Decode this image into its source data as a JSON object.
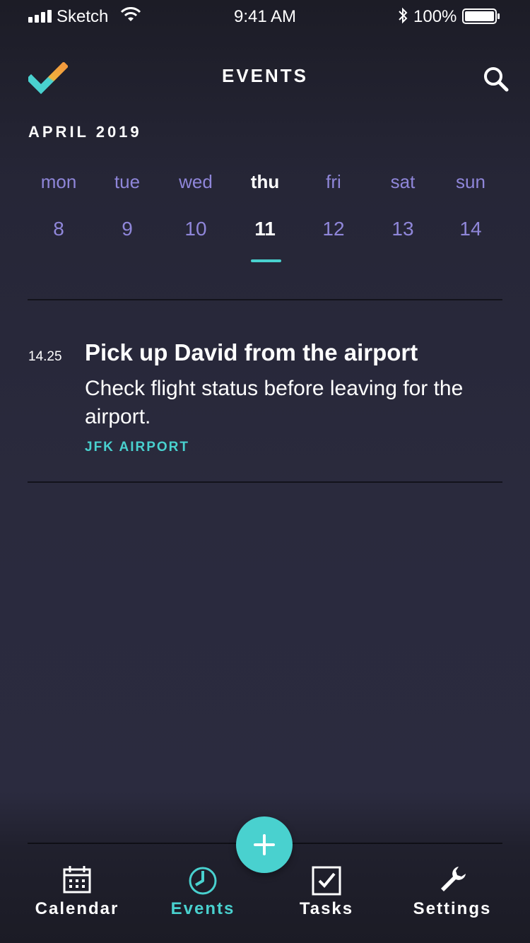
{
  "status_bar": {
    "carrier": "Sketch",
    "time": "9:41 AM",
    "battery": "100%"
  },
  "header": {
    "title": "EVENTS",
    "logo_icon": "checkmark-logo-icon",
    "search_icon": "search-icon"
  },
  "calendar": {
    "month": "APRIL 2019",
    "days": [
      {
        "name": "mon",
        "num": "8"
      },
      {
        "name": "tue",
        "num": "9"
      },
      {
        "name": "wed",
        "num": "10"
      },
      {
        "name": "thu",
        "num": "11"
      },
      {
        "name": "fri",
        "num": "12"
      },
      {
        "name": "sat",
        "num": "13"
      },
      {
        "name": "sun",
        "num": "14"
      }
    ],
    "selected_index": 3
  },
  "events": [
    {
      "time": "14.25",
      "title": "Pick up David from the airport",
      "description": "Check flight status before leaving for the airport.",
      "location": "JFK AIRPORT"
    }
  ],
  "fab": {
    "icon": "plus-icon"
  },
  "tabbar": {
    "items": [
      {
        "label": "Calendar",
        "icon": "calendar-icon"
      },
      {
        "label": "Events",
        "icon": "clock-icon"
      },
      {
        "label": "Tasks",
        "icon": "checkbox-icon"
      },
      {
        "label": "Settings",
        "icon": "wrench-icon"
      }
    ],
    "active_index": 1
  },
  "colors": {
    "accent": "#49d1cf",
    "weekday": "#8f86d9",
    "background": "#2a2a3d"
  }
}
